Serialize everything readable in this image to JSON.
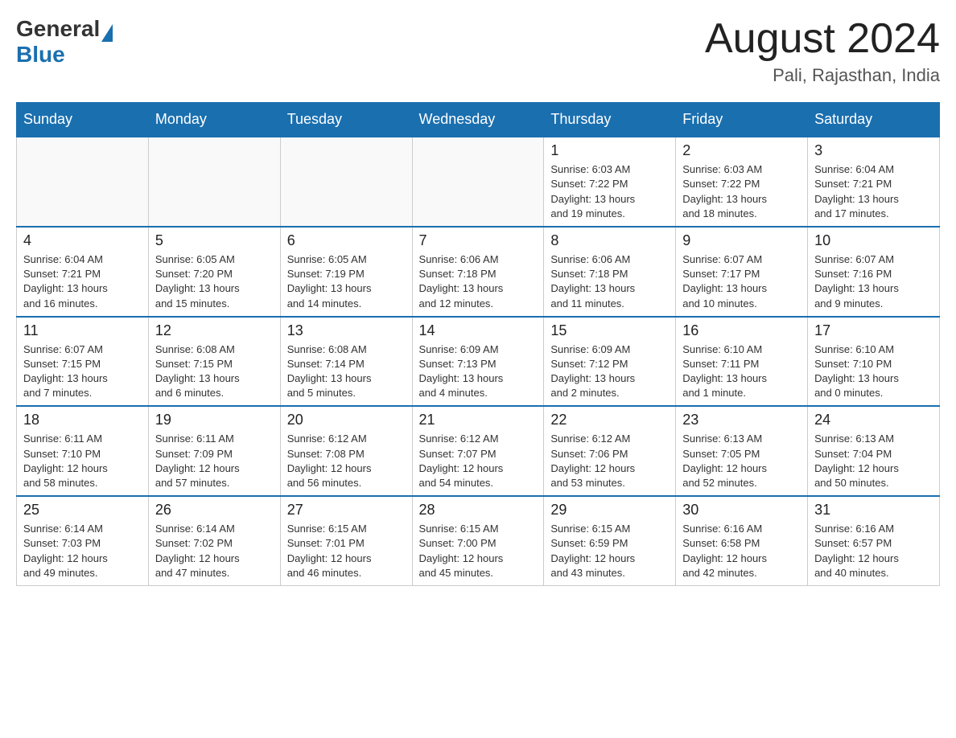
{
  "header": {
    "logo_general": "General",
    "logo_blue": "Blue",
    "month_title": "August 2024",
    "location": "Pali, Rajasthan, India"
  },
  "days_of_week": [
    "Sunday",
    "Monday",
    "Tuesday",
    "Wednesday",
    "Thursday",
    "Friday",
    "Saturday"
  ],
  "weeks": [
    [
      {
        "day": "",
        "info": ""
      },
      {
        "day": "",
        "info": ""
      },
      {
        "day": "",
        "info": ""
      },
      {
        "day": "",
        "info": ""
      },
      {
        "day": "1",
        "info": "Sunrise: 6:03 AM\nSunset: 7:22 PM\nDaylight: 13 hours\nand 19 minutes."
      },
      {
        "day": "2",
        "info": "Sunrise: 6:03 AM\nSunset: 7:22 PM\nDaylight: 13 hours\nand 18 minutes."
      },
      {
        "day": "3",
        "info": "Sunrise: 6:04 AM\nSunset: 7:21 PM\nDaylight: 13 hours\nand 17 minutes."
      }
    ],
    [
      {
        "day": "4",
        "info": "Sunrise: 6:04 AM\nSunset: 7:21 PM\nDaylight: 13 hours\nand 16 minutes."
      },
      {
        "day": "5",
        "info": "Sunrise: 6:05 AM\nSunset: 7:20 PM\nDaylight: 13 hours\nand 15 minutes."
      },
      {
        "day": "6",
        "info": "Sunrise: 6:05 AM\nSunset: 7:19 PM\nDaylight: 13 hours\nand 14 minutes."
      },
      {
        "day": "7",
        "info": "Sunrise: 6:06 AM\nSunset: 7:18 PM\nDaylight: 13 hours\nand 12 minutes."
      },
      {
        "day": "8",
        "info": "Sunrise: 6:06 AM\nSunset: 7:18 PM\nDaylight: 13 hours\nand 11 minutes."
      },
      {
        "day": "9",
        "info": "Sunrise: 6:07 AM\nSunset: 7:17 PM\nDaylight: 13 hours\nand 10 minutes."
      },
      {
        "day": "10",
        "info": "Sunrise: 6:07 AM\nSunset: 7:16 PM\nDaylight: 13 hours\nand 9 minutes."
      }
    ],
    [
      {
        "day": "11",
        "info": "Sunrise: 6:07 AM\nSunset: 7:15 PM\nDaylight: 13 hours\nand 7 minutes."
      },
      {
        "day": "12",
        "info": "Sunrise: 6:08 AM\nSunset: 7:15 PM\nDaylight: 13 hours\nand 6 minutes."
      },
      {
        "day": "13",
        "info": "Sunrise: 6:08 AM\nSunset: 7:14 PM\nDaylight: 13 hours\nand 5 minutes."
      },
      {
        "day": "14",
        "info": "Sunrise: 6:09 AM\nSunset: 7:13 PM\nDaylight: 13 hours\nand 4 minutes."
      },
      {
        "day": "15",
        "info": "Sunrise: 6:09 AM\nSunset: 7:12 PM\nDaylight: 13 hours\nand 2 minutes."
      },
      {
        "day": "16",
        "info": "Sunrise: 6:10 AM\nSunset: 7:11 PM\nDaylight: 13 hours\nand 1 minute."
      },
      {
        "day": "17",
        "info": "Sunrise: 6:10 AM\nSunset: 7:10 PM\nDaylight: 13 hours\nand 0 minutes."
      }
    ],
    [
      {
        "day": "18",
        "info": "Sunrise: 6:11 AM\nSunset: 7:10 PM\nDaylight: 12 hours\nand 58 minutes."
      },
      {
        "day": "19",
        "info": "Sunrise: 6:11 AM\nSunset: 7:09 PM\nDaylight: 12 hours\nand 57 minutes."
      },
      {
        "day": "20",
        "info": "Sunrise: 6:12 AM\nSunset: 7:08 PM\nDaylight: 12 hours\nand 56 minutes."
      },
      {
        "day": "21",
        "info": "Sunrise: 6:12 AM\nSunset: 7:07 PM\nDaylight: 12 hours\nand 54 minutes."
      },
      {
        "day": "22",
        "info": "Sunrise: 6:12 AM\nSunset: 7:06 PM\nDaylight: 12 hours\nand 53 minutes."
      },
      {
        "day": "23",
        "info": "Sunrise: 6:13 AM\nSunset: 7:05 PM\nDaylight: 12 hours\nand 52 minutes."
      },
      {
        "day": "24",
        "info": "Sunrise: 6:13 AM\nSunset: 7:04 PM\nDaylight: 12 hours\nand 50 minutes."
      }
    ],
    [
      {
        "day": "25",
        "info": "Sunrise: 6:14 AM\nSunset: 7:03 PM\nDaylight: 12 hours\nand 49 minutes."
      },
      {
        "day": "26",
        "info": "Sunrise: 6:14 AM\nSunset: 7:02 PM\nDaylight: 12 hours\nand 47 minutes."
      },
      {
        "day": "27",
        "info": "Sunrise: 6:15 AM\nSunset: 7:01 PM\nDaylight: 12 hours\nand 46 minutes."
      },
      {
        "day": "28",
        "info": "Sunrise: 6:15 AM\nSunset: 7:00 PM\nDaylight: 12 hours\nand 45 minutes."
      },
      {
        "day": "29",
        "info": "Sunrise: 6:15 AM\nSunset: 6:59 PM\nDaylight: 12 hours\nand 43 minutes."
      },
      {
        "day": "30",
        "info": "Sunrise: 6:16 AM\nSunset: 6:58 PM\nDaylight: 12 hours\nand 42 minutes."
      },
      {
        "day": "31",
        "info": "Sunrise: 6:16 AM\nSunset: 6:57 PM\nDaylight: 12 hours\nand 40 minutes."
      }
    ]
  ]
}
